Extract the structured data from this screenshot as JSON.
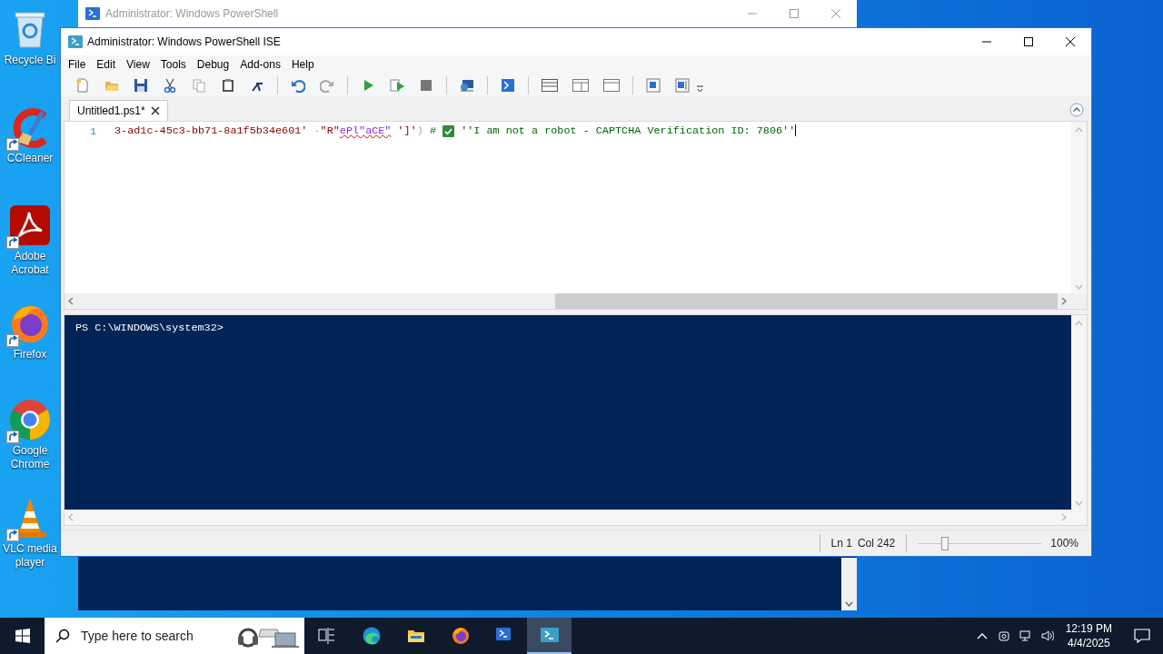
{
  "desktop_icons": [
    {
      "label": "Recycle Bi",
      "shortcut": false
    },
    {
      "label": "CCleaner",
      "shortcut": true
    },
    {
      "label": "Adobe Acrobat",
      "shortcut": true
    },
    {
      "label": "Firefox",
      "shortcut": true
    },
    {
      "label": "Google Chrome",
      "shortcut": true
    },
    {
      "label": "VLC media player",
      "shortcut": true
    }
  ],
  "back_window": {
    "title": "Administrator: Windows PowerShell"
  },
  "ise_window": {
    "title": "Administrator: Windows PowerShell ISE",
    "menu": [
      "File",
      "Edit",
      "View",
      "Tools",
      "Debug",
      "Add-ons",
      "Help"
    ],
    "tabs": [
      {
        "label": "Untitled1.ps1*",
        "selected": true
      }
    ],
    "editor": {
      "line_numbers": [
        "1"
      ],
      "tokens": [
        {
          "kind": "string",
          "text": "3-ad1c-45c3-bb71-8a1f5b34e601'",
          "error": false
        },
        {
          "kind": "operator",
          "text": " -",
          "error": false
        },
        {
          "kind": "string",
          "text": "\"R\"",
          "error": false
        },
        {
          "kind": "argument",
          "text": "ePl\"aCE\"",
          "error": true
        },
        {
          "kind": "string",
          "text": " ']'",
          "error": false
        },
        {
          "kind": "operator",
          "text": ")",
          "error": false
        },
        {
          "kind": "comment",
          "text": " #",
          "error": false
        },
        {
          "kind": "emoji"
        },
        {
          "kind": "comment",
          "text": " ''I am not a robot - CAPTCHA Verification ID: 7806''",
          "error": false
        }
      ]
    },
    "console": {
      "prompt": "PS C:\\WINDOWS\\system32>"
    },
    "status_bar": {
      "line": "Ln 1",
      "column": "Col 242",
      "zoom_slider": {
        "level": 0.22
      },
      "zoom": "100%"
    }
  },
  "taskbar": {
    "search": {
      "placeholder": "Type here to search"
    },
    "apps": [
      {
        "selected": false
      },
      {
        "selected": false
      },
      {
        "selected": false
      },
      {
        "selected": false
      },
      {
        "selected": false
      },
      {
        "selected": true
      }
    ],
    "clock": {
      "time": "12:19 PM",
      "date": "4/4/2025"
    }
  }
}
